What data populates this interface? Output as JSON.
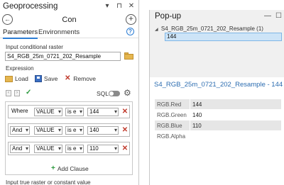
{
  "geoprocessing": {
    "title": "Geoprocessing",
    "tool_name": "Con",
    "tabs": [
      "Parameters",
      "Environments"
    ],
    "input_conditional_label": "Input conditional raster",
    "input_conditional_value": "S4_RGB_25m_0721_202_Resample",
    "expression_label": "Expression",
    "actions": {
      "load": "Load",
      "save": "Save",
      "remove": "Remove"
    },
    "sql_label": "SQL",
    "clauses": [
      {
        "logic": "Where",
        "field": "VALUE",
        "operator": "is e",
        "value": "144"
      },
      {
        "logic": "And",
        "field": "VALUE",
        "operator": "is e",
        "value": "140"
      },
      {
        "logic": "And",
        "field": "VALUE",
        "operator": "is e",
        "value": "110"
      }
    ],
    "add_clause_label": "Add Clause",
    "next_label": "Input true raster or constant value"
  },
  "popup": {
    "title": "Pop-up",
    "layer_name": "S4_RGB_25m_0721_202_Resample (1)",
    "feature_value": "144",
    "heading": "S4_RGB_25m_0721_202_Resample - 144",
    "attributes": [
      {
        "key": "RGB.Red",
        "value": "144"
      },
      {
        "key": "RGB.Green",
        "value": "140"
      },
      {
        "key": "RGB.Blue",
        "value": "110"
      },
      {
        "key": "RGB.Alpha",
        "value": ""
      }
    ]
  },
  "colors": {
    "accent_blue": "#2b7cd3",
    "remove_red": "#c0392b",
    "add_green": "#2c9a3e",
    "selection_blue": "#cde4f7"
  }
}
